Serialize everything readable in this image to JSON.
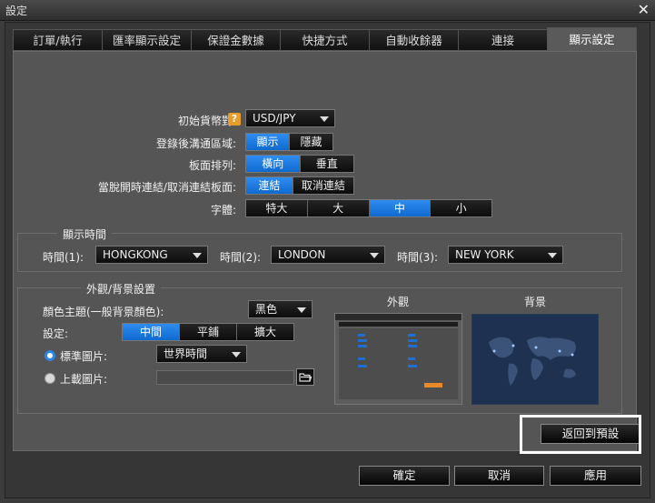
{
  "window": {
    "title": "設定",
    "close_glyph": "✕"
  },
  "tabs": [
    {
      "label": "訂單/執行"
    },
    {
      "label": "匯率顯示設定"
    },
    {
      "label": "保證金數據"
    },
    {
      "label": "快捷方式"
    },
    {
      "label": "自動收餘器"
    },
    {
      "label": "連接"
    },
    {
      "label": "顯示設定",
      "active": true
    }
  ],
  "display": {
    "initial_pair_label": "初始貨幣對:",
    "help_glyph": "?",
    "initial_pair_value": "USD/JPY",
    "chat_area_label": "登錄後溝通區域:",
    "chat_area_options": [
      "顯示",
      "隱藏"
    ],
    "chat_area_selected": "顯示",
    "board_arrange_label": "板面排列:",
    "board_arrange_options": [
      "橫向",
      "垂直"
    ],
    "board_arrange_selected": "橫向",
    "link_label": "當脫開時連結/取消連結板面:",
    "link_options": [
      "連結",
      "取消連結"
    ],
    "link_selected": "連結",
    "font_label": "字體:",
    "font_options": [
      "特大",
      "大",
      "中",
      "小"
    ],
    "font_selected": "中"
  },
  "time_group": {
    "title": "顯示時間",
    "time1_label": "時間(1):",
    "time1_value": "HONGKONG",
    "time2_label": "時間(2):",
    "time2_value": "LONDON",
    "time3_label": "時間(3):",
    "time3_value": "NEW YORK"
  },
  "appearance": {
    "title": "外觀/背景設置",
    "theme_label": "顏色主題(一般背景顏色):",
    "theme_value": "黑色",
    "setting_label": "設定:",
    "setting_options": [
      "中間",
      "平鋪",
      "擴大"
    ],
    "setting_selected": "中間",
    "standard_image_label": "標準圖片:",
    "standard_image_value": "世界時間",
    "upload_image_label": "上載圖片:",
    "preview_appearance_label": "外觀",
    "preview_background_label": "背景"
  },
  "buttons": {
    "restore_default": "返回到預設",
    "ok": "確定",
    "cancel": "取消",
    "apply": "應用"
  },
  "colors": {
    "accent": "#1a7ae0",
    "help": "#e89c2c",
    "map_bg": "#1f3150"
  }
}
